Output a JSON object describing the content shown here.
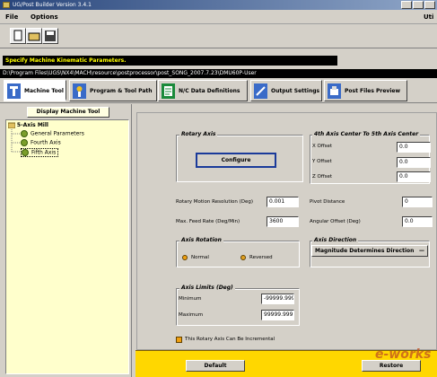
{
  "window": {
    "title": "UG/Post Builder Version 3.4.1"
  },
  "menu": {
    "file": "File",
    "options": "Options",
    "utilities": "Uti"
  },
  "status": "Specify Machine Kinematic Parameters.",
  "path": "D:\\Program Files\\UGS\\NX4\\MACH\\resource\\postprocessor\\post_SONG_2007.7.23\\DMU60P-User",
  "tabs": [
    "Machine Tool",
    "Program & Tool Path",
    "N/C Data Definitions",
    "Output Settings",
    "Post Files Preview"
  ],
  "left": {
    "display_button": "Display Machine Tool",
    "tree": {
      "root": "5-Axis Mill",
      "items": [
        "General Parameters",
        "Fourth Axis",
        "Fifth Axis"
      ]
    }
  },
  "rotary": {
    "title": "Rotary Axis",
    "configure": "Configure"
  },
  "center": {
    "title": "4th Axis Center To 5th Axis Center",
    "x_label": "X Offset",
    "x_val": "0.0",
    "y_label": "Y Offset",
    "y_val": "0.0",
    "z_label": "Z Offset",
    "z_val": "0.0"
  },
  "params": {
    "res_label": "Rotary Motion Resolution (Deg)",
    "res_val": "0.001",
    "feed_label": "Max. Feed Rate (Deg/Min)",
    "feed_val": "3600",
    "pivot_label": "Pivot Distance",
    "pivot_val": "0",
    "angular_label": "Angular Offset (Deg)",
    "angular_val": "0.0"
  },
  "rotation": {
    "title": "Axis Rotation",
    "normal": "Normal",
    "reversed": "Reversed"
  },
  "direction": {
    "title": "Axis Direction",
    "value": "Magnitude Determines Direction"
  },
  "limits": {
    "title": "Axis Limits (Deg)",
    "min_label": "Minimum",
    "min_val": "-99999.999",
    "max_label": "Maximum",
    "max_val": "99999.999"
  },
  "incremental": "This Rotary Axis Can Be Incremental",
  "buttons": {
    "default": "Default",
    "restore": "Restore"
  },
  "watermark": "e-works"
}
